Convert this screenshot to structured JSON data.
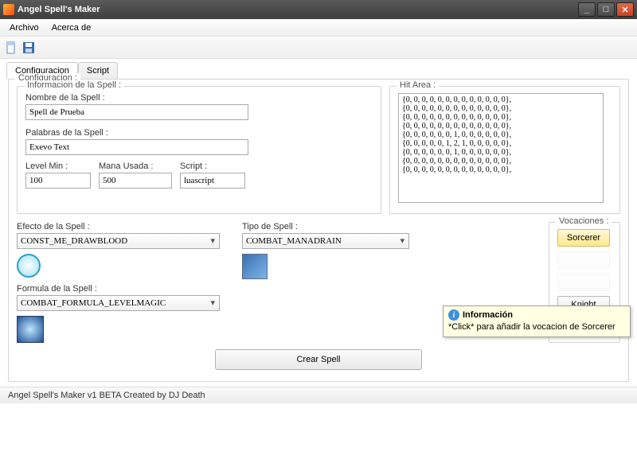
{
  "window": {
    "title": "Angel Spell's Maker"
  },
  "menu": {
    "archivo": "Archivo",
    "acerca": "Acerca de"
  },
  "tabs": {
    "config": "Configuracion",
    "script": "Script"
  },
  "group_config": "Configuracion :",
  "group_info": "Informacion de la Spell :",
  "labels": {
    "nombre": "Nombre de la Spell :",
    "palabras": "Palabras de la Spell :",
    "levelmin": "Level Min :",
    "mana": "Mana Usada :",
    "script": "Script :",
    "hitarea": "Hit Area :",
    "efecto": "Efecto de la Spell :",
    "tipo": "Tipo de Spell :",
    "formula": "Formula de la Spell :",
    "vocaciones": "Vocaciones :"
  },
  "values": {
    "nombre": "Spell de Prueba",
    "palabras": "Exevo Text",
    "levelmin": "100",
    "mana": "500",
    "script": "luascript",
    "efecto": "CONST_ME_DRAWBLOOD",
    "tipo": "COMBAT_MANADRAIN",
    "formula": "COMBAT_FORMULA_LEVELMAGIC"
  },
  "hitarea": "{0, 0, 0, 0, 0, 0, 0, 0, 0, 0, 0, 0, 0},\n{0, 0, 0, 0, 0, 0, 0, 0, 0, 0, 0, 0, 0},\n{0, 0, 0, 0, 0, 0, 0, 0, 0, 0, 0, 0, 0},\n{0, 0, 0, 0, 0, 0, 0, 0, 0, 0, 0, 0, 0},\n{0, 0, 0, 0, 0, 0, 1, 0, 0, 0, 0, 0, 0},\n{0, 0, 0, 0, 0, 1, 2, 1, 0, 0, 0, 0, 0},\n{0, 0, 0, 0, 0, 0, 1, 0, 0, 0, 0, 0, 0},\n{0, 0, 0, 0, 0, 0, 0, 0, 0, 0, 0, 0, 0},\n{0, 0, 0, 0, 0, 0, 0, 0, 0, 0, 0, 0, 0},",
  "vocations": {
    "sorcerer": "Sorcerer",
    "knight": "Knight"
  },
  "tooltip": {
    "title": "Información",
    "body": "*Click* para añadir la vocacion de Sorcerer"
  },
  "create_btn": "Crear Spell",
  "status": "Angel Spell's Maker v1 BETA Created by DJ Death"
}
